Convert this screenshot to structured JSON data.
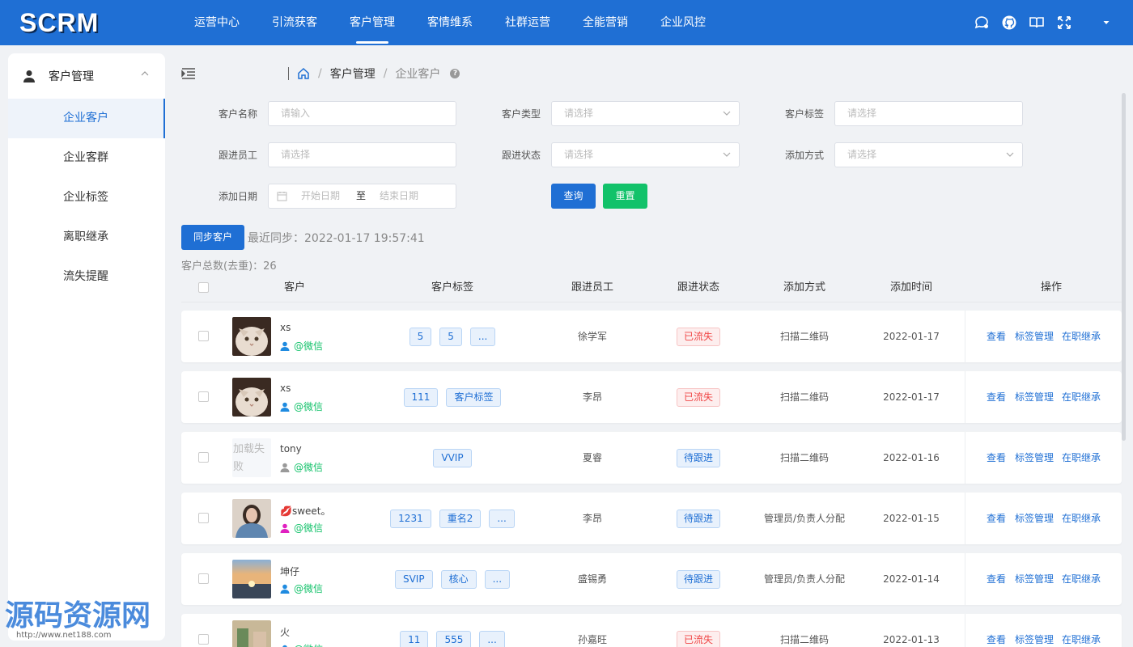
{
  "app": {
    "logo": "SCRM"
  },
  "nav": {
    "items": [
      "运营中心",
      "引流获客",
      "客户管理",
      "客情维系",
      "社群运营",
      "全能营销",
      "企业风控"
    ],
    "active_index": 2
  },
  "topbar": {
    "icons": [
      "chat-icon",
      "github-icon",
      "book-icon",
      "fullscreen-icon"
    ]
  },
  "sidebar": {
    "group_label": "客户管理",
    "items": [
      "企业客户",
      "企业客群",
      "企业标签",
      "离职继承",
      "流失提醒"
    ],
    "active_index": 0
  },
  "breadcrumb": {
    "section": "客户管理",
    "page": "企业客户",
    "help": "?"
  },
  "filters": {
    "name_label": "客户名称",
    "name_placeholder": "请输入",
    "type_label": "客户类型",
    "type_placeholder": "请选择",
    "tag_label": "客户标签",
    "tag_placeholder": "请选择",
    "staff_label": "跟进员工",
    "staff_placeholder": "请选择",
    "follow_label": "跟进状态",
    "follow_placeholder": "请选择",
    "add_label": "添加方式",
    "add_placeholder": "请选择",
    "date_label": "添加日期",
    "date_start": "开始日期",
    "date_to": "至",
    "date_end": "结束日期",
    "query_button": "查询",
    "reset_button": "重置"
  },
  "sync": {
    "button": "同步客户",
    "last_sync": "最近同步：2022-01-17 19:57:41"
  },
  "total": "客户总数(去重)：26",
  "table": {
    "headers": {
      "customer": "客户",
      "tags": "客户标签",
      "staff": "跟进员工",
      "status": "跟进状态",
      "method": "添加方式",
      "time": "添加时间",
      "actions": "操作"
    },
    "action_labels": {
      "view": "查看",
      "tags": "标签管理",
      "inherit": "在职继承"
    },
    "rows": [
      {
        "name": "xs",
        "source": "@微信",
        "avatar": "cat",
        "tags": [
          "5",
          "5",
          "..."
        ],
        "staff": "徐学军",
        "status": "已流失",
        "status_kind": "lost",
        "method": "扫描二维码",
        "time": "2022-01-17",
        "person_color": "#1f8be0"
      },
      {
        "name": "xs",
        "source": "@微信",
        "avatar": "cat",
        "tags": [
          "111",
          "客户标签"
        ],
        "staff": "李昂",
        "status": "已流失",
        "status_kind": "lost",
        "method": "扫描二维码",
        "time": "2022-01-17",
        "person_color": "#1f8be0"
      },
      {
        "name": "tony",
        "source": "@微信",
        "avatar": "fail",
        "avatar_text": "加载失败",
        "tags": [
          "VVIP"
        ],
        "staff": "夏睿",
        "status": "待跟进",
        "status_kind": "wait",
        "method": "扫描二维码",
        "time": "2022-01-16",
        "person_color": "#999999"
      },
      {
        "name": "💋sweet。",
        "source": "@微信",
        "avatar": "girl",
        "tags": [
          "1231",
          "重名2",
          "..."
        ],
        "staff": "李昂",
        "status": "待跟进",
        "status_kind": "wait",
        "method": "管理员/负责人分配",
        "time": "2022-01-15",
        "person_color": "#e020c0"
      },
      {
        "name": "坤仔",
        "source": "@微信",
        "avatar": "sunset",
        "tags": [
          "SVIP",
          "核心",
          "..."
        ],
        "staff": "盛锡勇",
        "status": "待跟进",
        "status_kind": "wait",
        "method": "管理员/负责人分配",
        "time": "2022-01-14",
        "person_color": "#1f8be0"
      },
      {
        "name": "火",
        "source": "@微信",
        "avatar": "sunset2",
        "tags": [
          "11",
          "555",
          "..."
        ],
        "staff": "孙嘉旺",
        "status": "已流失",
        "status_kind": "lost",
        "method": "扫描二维码",
        "time": "2022-01-13",
        "person_color": "#1f8be0"
      }
    ]
  },
  "watermark": {
    "text": "源码资源网",
    "url": "http://www.net188.com"
  }
}
